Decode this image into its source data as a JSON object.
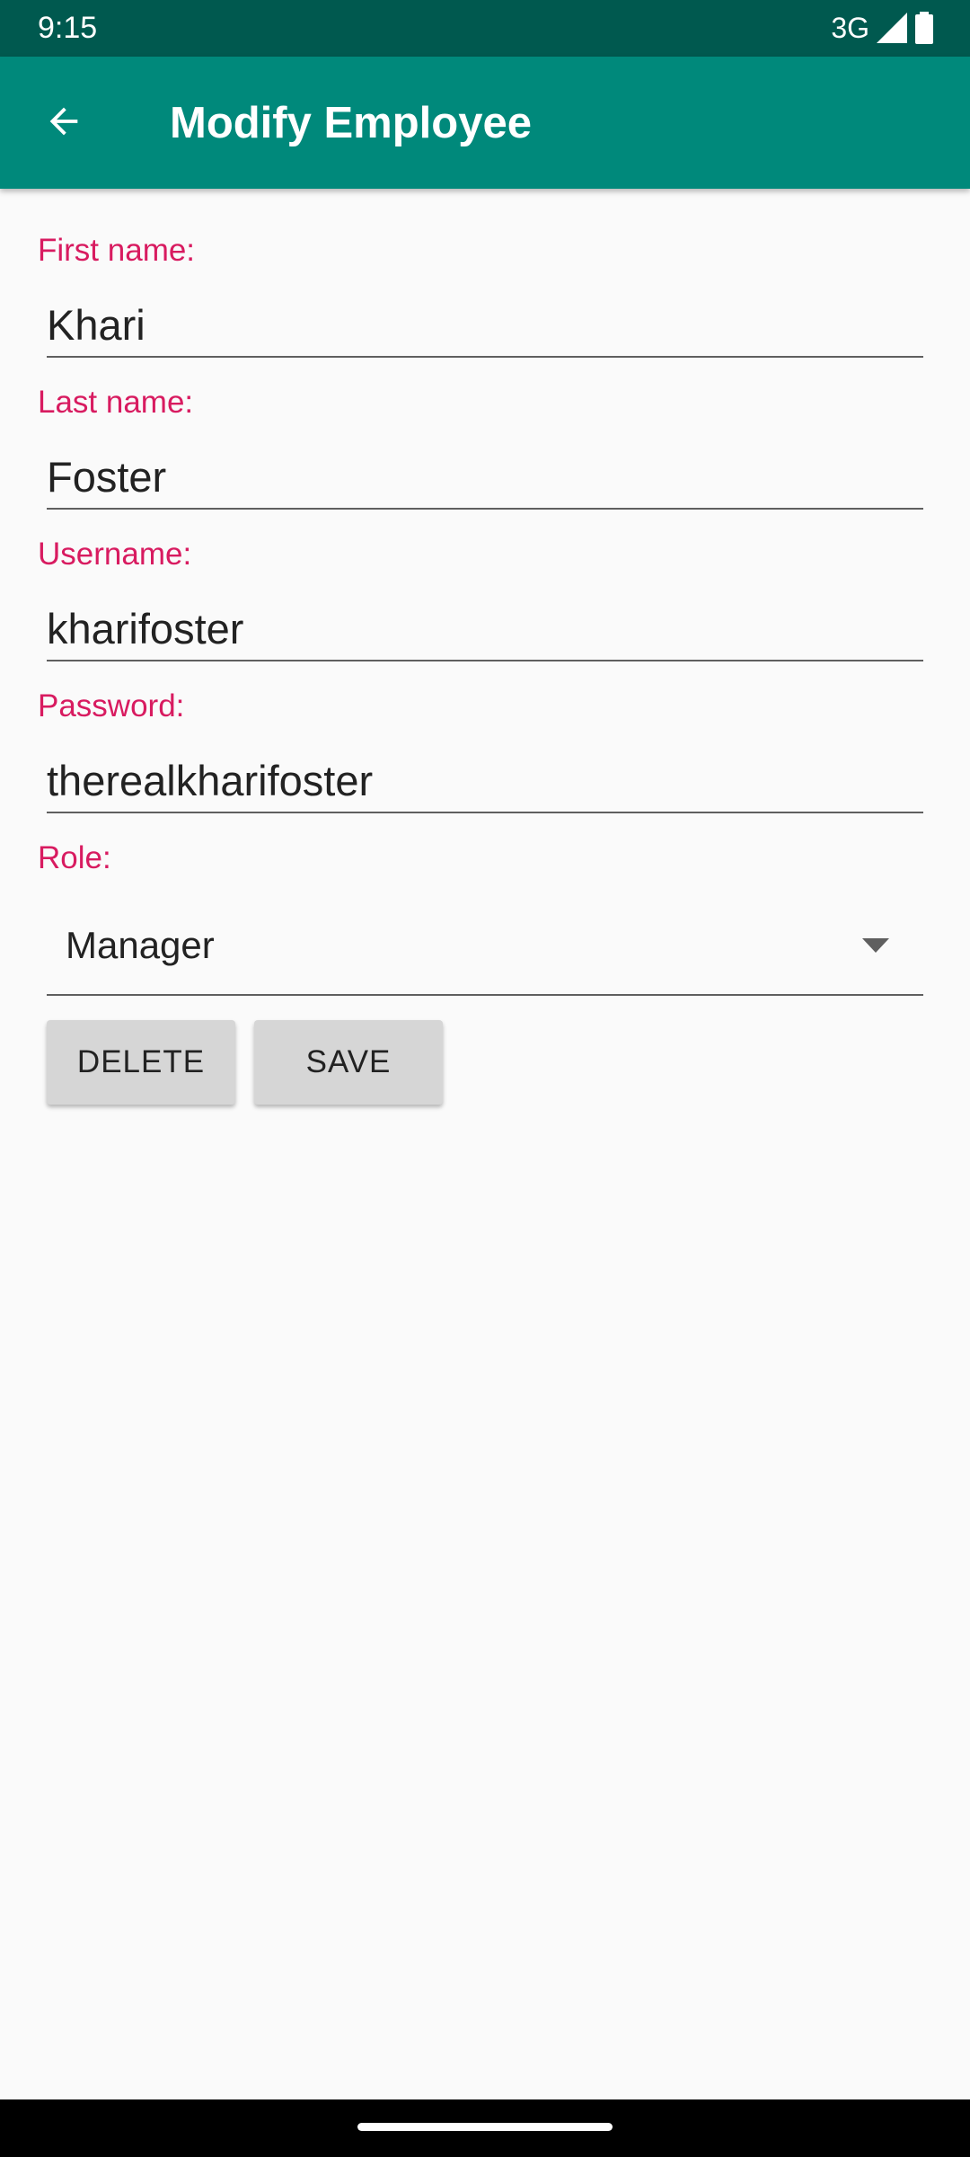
{
  "status_bar": {
    "time": "9:15",
    "network": "3G",
    "signal_icon": "signal-icon",
    "battery_icon": "battery-icon"
  },
  "app_bar": {
    "back_icon": "arrow-left-icon",
    "title": "Modify Employee"
  },
  "form": {
    "first_name": {
      "label": "First name:",
      "value": "Khari"
    },
    "last_name": {
      "label": "Last name:",
      "value": "Foster"
    },
    "username": {
      "label": "Username:",
      "value": "kharifoster"
    },
    "password": {
      "label": "Password:",
      "value": "therealkharifoster"
    },
    "role": {
      "label": "Role:",
      "selected": "Manager"
    }
  },
  "buttons": {
    "delete": "DELETE",
    "save": "SAVE"
  },
  "colors": {
    "status_bar": "#00594f",
    "app_bar": "#00897b",
    "label_accent": "#d81b60",
    "button_bg": "#d6d6d6"
  }
}
